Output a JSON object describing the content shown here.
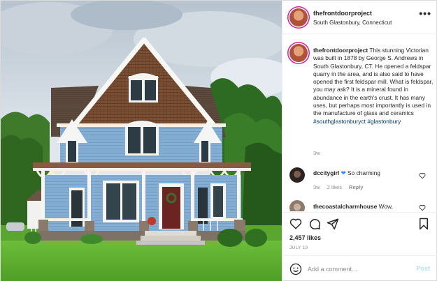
{
  "photo": {
    "alt_icon": "photo-victorian-house"
  },
  "header": {
    "username": "thefrontdoorproject",
    "location": "South Glastonbury, Connecticut",
    "more_icon": "more-options-icon",
    "more_label": "•••"
  },
  "caption": {
    "username": "thefrontdoorproject",
    "text": "This stunning Victorian was built in 1878 by George S. Andrews in South Glastonbury, CT. He opened a feldspar quarry in the area, and is also said to have opened the first feldspar mill. What is feldspar, you may ask? It is a mineral found in abundance in the earth's crust. It has many uses, but perhaps most importantly is used in the manufacture of glass and ceramics",
    "hashtags": [
      "#southglastonburyct",
      "#glastonbury"
    ],
    "time": "3w"
  },
  "comments": [
    {
      "username": "dccitygirl",
      "text": "So charming",
      "time": "3w",
      "likes": "2 likes",
      "reply": "Reply",
      "emoji_icon": "blue-heart-emoji"
    },
    {
      "username": "thecoastalcharmhouse",
      "text": "Wow,",
      "time": "",
      "likes": "",
      "reply": ""
    }
  ],
  "actions": {
    "icons": [
      "heart-icon",
      "comment-icon",
      "share-icon",
      "save-icon"
    ],
    "likes": "2,457 likes",
    "date": "JULY 19"
  },
  "add_comment": {
    "placeholder": "Add a comment...",
    "post_label": "Post"
  },
  "colors": {
    "hashtag": "#00376b",
    "post_button_disabled": "#b2dffc",
    "secondary_text": "#8e8e8e",
    "house_blue": "#7fa8cf",
    "roof_brown": "#6b4a34"
  }
}
